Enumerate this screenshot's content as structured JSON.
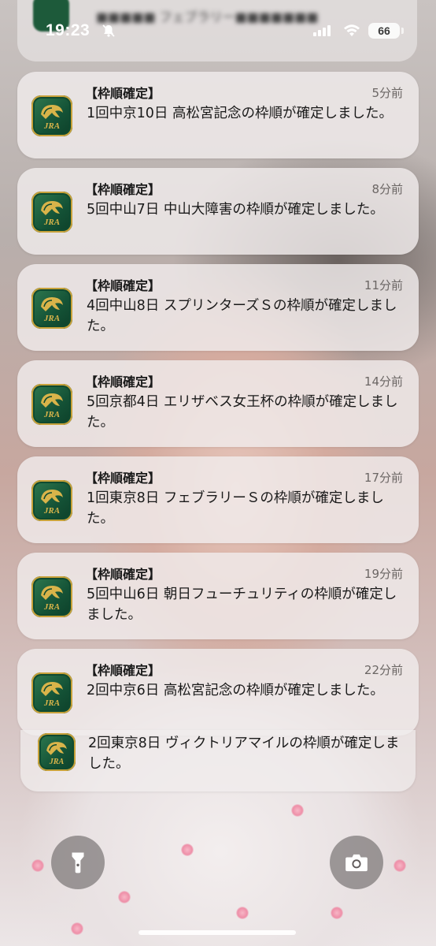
{
  "status_bar": {
    "time": "19:23",
    "battery": "66"
  },
  "app_icon": {
    "name": "jra-app-icon",
    "label": "JRA"
  },
  "notifications": [
    {
      "title": "【枠順確定】",
      "time": "5分前",
      "body": "1回中京10日 高松宮記念の枠順が確定しました。"
    },
    {
      "title": "【枠順確定】",
      "time": "8分前",
      "body": "5回中山7日 中山大障害の枠順が確定しました。"
    },
    {
      "title": "【枠順確定】",
      "time": "11分前",
      "body": "4回中山8日 スプリンターズＳの枠順が確定しました。"
    },
    {
      "title": "【枠順確定】",
      "time": "14分前",
      "body": "5回京都4日 エリザベス女王杯の枠順が確定しました。"
    },
    {
      "title": "【枠順確定】",
      "time": "17分前",
      "body": "1回東京8日 フェブラリーＳの枠順が確定しました。"
    },
    {
      "title": "【枠順確定】",
      "time": "19分前",
      "body": "5回中山6日 朝日フューチュリティの枠順が確定しました。"
    },
    {
      "title": "【枠順確定】",
      "time": "22分前",
      "body": "2回中京6日 高松宮記念の枠順が確定しました。"
    }
  ],
  "stacked_notification": {
    "body": "2回東京8日 ヴィクトリアマイルの枠順が確定しました。"
  },
  "buttons": {
    "flashlight": "flashlight-icon",
    "camera": "camera-icon"
  },
  "colors": {
    "icon_green": "#145236",
    "icon_gold": "#c8a23a",
    "card_bg": "#f0ecec"
  }
}
